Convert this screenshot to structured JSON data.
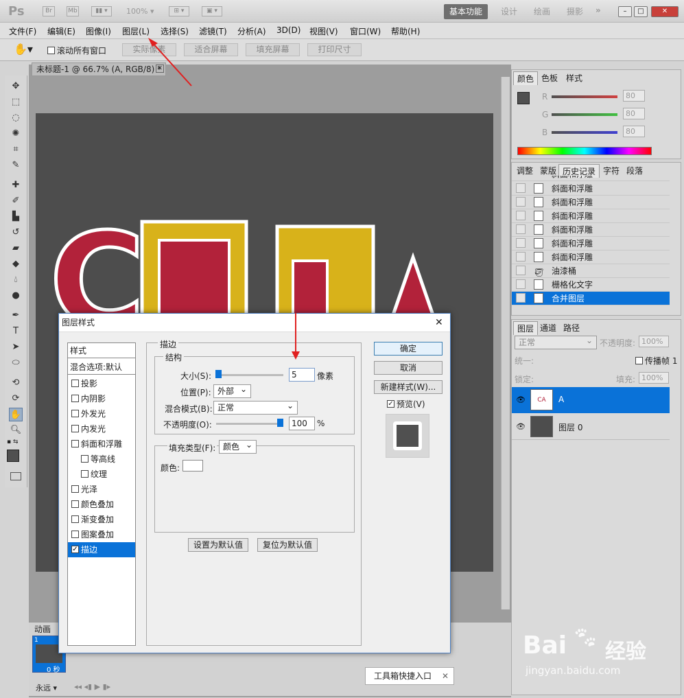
{
  "app": {
    "logo": "Ps",
    "mini_br": "Br",
    "mini_mb": "Mb",
    "zoom_select": "100%",
    "workspaces": [
      "基本功能",
      "设计",
      "绘画",
      "摄影"
    ],
    "more": "»"
  },
  "menu": [
    "文件(F)",
    "编辑(E)",
    "图像(I)",
    "图层(L)",
    "选择(S)",
    "滤镜(T)",
    "分析(A)",
    "3D(D)",
    "视图(V)",
    "窗口(W)",
    "帮助(H)"
  ],
  "options": {
    "scroll_all": "滚动所有窗口",
    "actual_pixels": "实际像素",
    "fit_screen": "适合屏幕",
    "fill_screen": "填充屏幕",
    "print_size": "打印尺寸"
  },
  "document": {
    "tab_title": "未标题-1 @ 66.7% (A, RGB/8) *",
    "zoom": "66.67%"
  },
  "color_panel": {
    "tabs": [
      "颜色",
      "色板",
      "样式"
    ],
    "r_label": "R",
    "g_label": "G",
    "b_label": "B",
    "r": "80",
    "g": "80",
    "b": "80"
  },
  "history_panel": {
    "tabs": [
      "调整",
      "蒙版",
      "历史记录",
      "字符",
      "段落"
    ],
    "items": [
      "斜面和浮雕",
      "斜面和浮雕",
      "斜面和浮雕",
      "斜面和浮雕",
      "斜面和浮雕",
      "斜面和浮雕",
      "斜面和浮雕",
      "油漆桶",
      "栅格化文字",
      "合并图层"
    ]
  },
  "layers_panel": {
    "tabs": [
      "图层",
      "通道",
      "路径"
    ],
    "blend": "正常",
    "opacity_label": "不透明度:",
    "opacity": "100%",
    "unify": "统一:",
    "propagate": "传播帧 1",
    "lock": "锁定:",
    "fill_label": "填充:",
    "fill": "100%",
    "layers": [
      {
        "name": "A",
        "selected": true
      },
      {
        "name": "图层 0",
        "selected": false
      }
    ]
  },
  "animation_panel": {
    "tab": "动画",
    "frame_num": "1",
    "frame_time": "0 秒",
    "loop": "永远"
  },
  "dialog": {
    "title": "图层样式",
    "styles_header": "样式",
    "blend_default": "混合选项:默认",
    "styles": [
      {
        "label": "投影",
        "checked": false,
        "indent": false
      },
      {
        "label": "内阴影",
        "checked": false,
        "indent": false
      },
      {
        "label": "外发光",
        "checked": false,
        "indent": false
      },
      {
        "label": "内发光",
        "checked": false,
        "indent": false
      },
      {
        "label": "斜面和浮雕",
        "checked": false,
        "indent": false
      },
      {
        "label": "等高线",
        "checked": false,
        "indent": true
      },
      {
        "label": "纹理",
        "checked": false,
        "indent": true
      },
      {
        "label": "光泽",
        "checked": false,
        "indent": false
      },
      {
        "label": "颜色叠加",
        "checked": false,
        "indent": false
      },
      {
        "label": "渐变叠加",
        "checked": false,
        "indent": false
      },
      {
        "label": "图案叠加",
        "checked": false,
        "indent": false
      },
      {
        "label": "描边",
        "checked": true,
        "indent": false
      }
    ],
    "stroke_title": "描边",
    "structure": "结构",
    "size_label": "大小(S):",
    "size": "5",
    "size_unit": "像素",
    "position_label": "位置(P):",
    "position": "外部",
    "blend_label": "混合模式(B):",
    "blend": "正常",
    "opacity_label": "不透明度(O):",
    "opacity": "100",
    "opacity_unit": "%",
    "opacity_level": 1.0,
    "size_level": 0.03,
    "fill_type_label": "填充类型(F):",
    "fill_type": "颜色",
    "color_label": "颜色:",
    "set_default": "设置为默认值",
    "reset_default": "复位为默认值",
    "ok": "确定",
    "cancel": "取消",
    "new_style": "新建样式(W)...",
    "preview": "预览(V)"
  },
  "canvas_text": "C国庆A",
  "toolbox_tip": "工具箱快捷入口",
  "watermark": {
    "brand": "Bai",
    "brand_cn": "经验",
    "url": "jingyan.baidu.com"
  },
  "colors": {
    "accent": "#0a72d8",
    "arrow": "#e02020",
    "letter_red": "#b2223a",
    "letter_gold": "#d8b21a"
  }
}
